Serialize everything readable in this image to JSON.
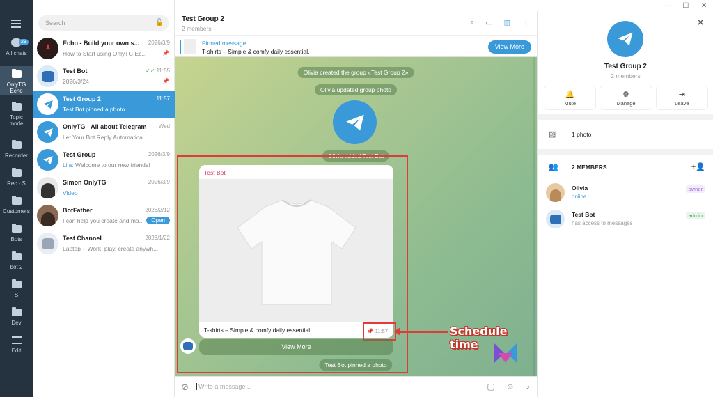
{
  "window": {
    "controls": [
      "—",
      "☐",
      "✕"
    ]
  },
  "folders": {
    "unread_badge": "29",
    "items": [
      {
        "label": "All chats"
      },
      {
        "label": "OnlyTG Echo"
      },
      {
        "label": "Topic mode"
      },
      {
        "label": "Recorder"
      },
      {
        "label": "Rec - S"
      },
      {
        "label": "Customers"
      },
      {
        "label": "Bots"
      },
      {
        "label": "bot 2"
      },
      {
        "label": "S"
      },
      {
        "label": "Dev"
      },
      {
        "label": "Edit"
      }
    ]
  },
  "chatlist": {
    "search_placeholder": "Search",
    "chats": [
      {
        "name": "Echo - Build your own s...",
        "date": "2026/3/9",
        "preview": "How to Start using OnlyTG Ec..."
      },
      {
        "name": "Test Bot",
        "date": "11:55",
        "preview": "2026/3/24"
      },
      {
        "name": "Test Group 2",
        "date": "11:57",
        "preview": "Test Bot pinned a photo"
      },
      {
        "name": "OnlyTG - All about Telegram",
        "date": "Wed",
        "preview": "Let Your Bot Reply Automatica..."
      },
      {
        "name": "Test Group",
        "date": "2026/3/9",
        "preview_sender": "Lila:",
        "preview": "Welcome to our new friends!"
      },
      {
        "name": "Simon OnlyTG",
        "date": "2026/3/9",
        "preview": "Video"
      },
      {
        "name": "BotFather",
        "date": "2026/2/12",
        "preview": "I can help you create and ma...",
        "action": "Open"
      },
      {
        "name": "Test Channel",
        "date": "2026/1/22",
        "preview": "Laptop – Work, play, create anywh..."
      }
    ]
  },
  "header": {
    "title": "Test Group 2",
    "subtitle": "2 members"
  },
  "pinned": {
    "title": "Pinned message",
    "text": "T-shirts – Simple & comfy daily essential.",
    "button": "View More"
  },
  "messages": {
    "service_1": "Olivia created the group «Test Group 2»",
    "service_2": "Olivia updated group photo",
    "service_3": "Olivia added Test Bot",
    "service_4": "Test Bot pinned a photo",
    "bubble": {
      "sender": "Test Bot",
      "caption": "T-shirts – Simple & comfy daily essential.",
      "time": "11:57",
      "button": "View More"
    },
    "annotation": "Schedule time"
  },
  "composer": {
    "placeholder": "Write a message..."
  },
  "info": {
    "title": "Test Group 2",
    "subtitle": "2 members",
    "actions": [
      {
        "label": "Mute"
      },
      {
        "label": "Manage"
      },
      {
        "label": "Leave"
      }
    ],
    "media_row": "1 photo",
    "members_head": "2 MEMBERS",
    "members": [
      {
        "name": "Olivia",
        "status": "online",
        "role": "owner"
      },
      {
        "name": "Test Bot",
        "status": "has access to messages",
        "role": "admin"
      }
    ]
  },
  "colors": {
    "accent": "#3a9ad9",
    "sidebar": "#253340",
    "annotation": "#e03a3a"
  }
}
